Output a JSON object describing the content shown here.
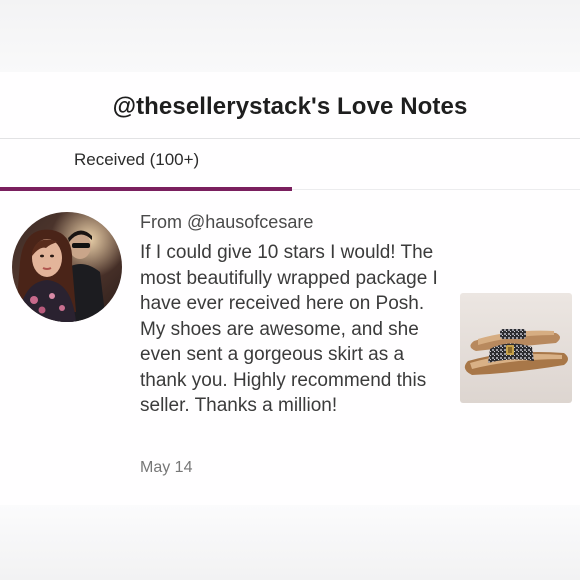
{
  "header": {
    "title": "@thesellerystack's Love Notes"
  },
  "tabs": [
    {
      "label": "Received (100+)",
      "active": true
    }
  ],
  "note": {
    "from": "From @hausofcesare",
    "message": "If I could give 10 stars I would! The most beautifully wrapped package I have ever received here on Posh. My shoes are awesome, and she even sent a gorgeous skirt as a thank you. Highly recommend this seller. Thanks a million!",
    "date": "May 14",
    "avatar_icon": "user-avatar-photo",
    "thumbnail_icon": "sandal-photo"
  },
  "colors": {
    "accent": "#7a1f5e",
    "title_text": "#1e1e1e",
    "body_text": "#3b3b3b",
    "muted_text": "#777777"
  }
}
